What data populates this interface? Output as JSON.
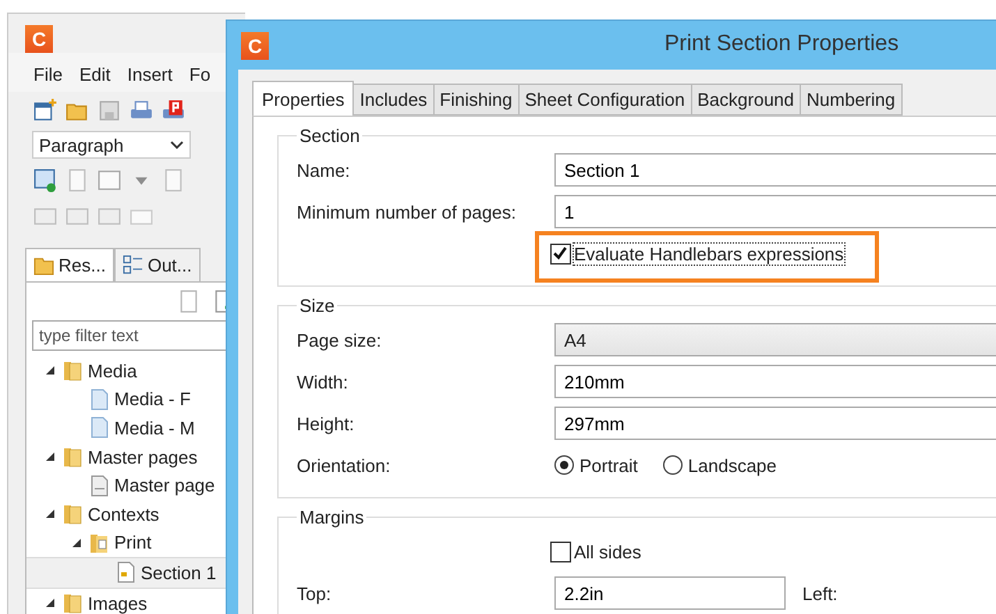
{
  "app": {
    "logo": "C",
    "menu": [
      "File",
      "Edit",
      "Insert",
      "Fo"
    ],
    "style_dropdown": {
      "value": "Paragraph"
    },
    "panel_tabs": [
      {
        "label": "Res...",
        "selected": true,
        "kind": "resources"
      },
      {
        "label": "Out...",
        "selected": false,
        "kind": "outline"
      }
    ],
    "filter": {
      "placeholder": "type filter text"
    },
    "tree": [
      {
        "label": "Media",
        "kind": "folder",
        "expanded": true,
        "selected": false,
        "children": [
          {
            "label": "Media - F",
            "kind": "file",
            "selected": false
          },
          {
            "label": "Media - M",
            "kind": "file",
            "selected": false
          }
        ]
      },
      {
        "label": "Master pages",
        "kind": "folder",
        "expanded": true,
        "selected": false,
        "children": [
          {
            "label": "Master page",
            "kind": "page",
            "selected": false
          }
        ]
      },
      {
        "label": "Contexts",
        "kind": "folder",
        "expanded": true,
        "selected": false,
        "children": [
          {
            "label": "Print",
            "kind": "context",
            "expanded": true,
            "selected": false,
            "children": [
              {
                "label": "Section 1",
                "kind": "section",
                "selected": true
              }
            ]
          }
        ]
      },
      {
        "label": "Images",
        "kind": "folder",
        "expanded": true,
        "selected": false
      }
    ]
  },
  "dialog": {
    "logo": "C",
    "title": "Print Section Properties",
    "tabs": [
      {
        "label": "Properties",
        "selected": true
      },
      {
        "label": "Includes",
        "selected": false
      },
      {
        "label": "Finishing",
        "selected": false
      },
      {
        "label": "Sheet Configuration",
        "selected": false
      },
      {
        "label": "Background",
        "selected": false
      },
      {
        "label": "Numbering",
        "selected": false
      }
    ],
    "section": {
      "legend": "Section",
      "rows": [
        {
          "kind": "text",
          "label": "Name:",
          "value": "Section 1"
        },
        {
          "kind": "text",
          "label": "Minimum number of pages:",
          "value": "1"
        },
        {
          "kind": "checkbox",
          "label": "Evaluate Handlebars expressions",
          "checked": true,
          "highlighted": true
        }
      ]
    },
    "size": {
      "legend": "Size",
      "rows": [
        {
          "kind": "select",
          "label": "Page size:",
          "value": "A4"
        },
        {
          "kind": "text",
          "label": "Width:",
          "value": "210mm"
        },
        {
          "kind": "text",
          "label": "Height:",
          "value": "297mm"
        },
        {
          "kind": "radio",
          "label": "Orientation:",
          "options": [
            {
              "label": "Portrait",
              "selected": true
            },
            {
              "label": "Landscape",
              "selected": false
            }
          ]
        }
      ]
    },
    "margins": {
      "legend": "Margins",
      "rows": [
        {
          "kind": "checkbox",
          "label": "All sides",
          "checked": false,
          "highlighted": false
        },
        {
          "kind": "pair",
          "label": "Top:",
          "value": "2.2in",
          "second_label": "Left:"
        }
      ]
    }
  }
}
